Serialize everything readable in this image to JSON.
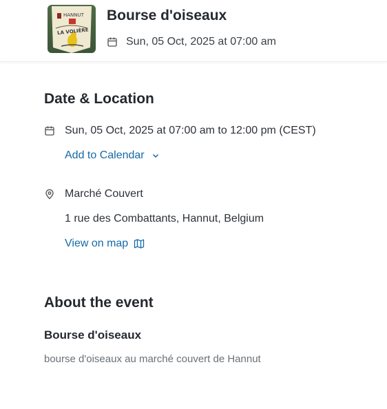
{
  "header": {
    "title": "Bourse d'oiseaux",
    "date": "Sun, 05 Oct, 2025 at 07:00 am",
    "thumbnail_icon": "event-poster-icon",
    "thumbnail_text_top": "HANNUT",
    "thumbnail_text_middle": "LA VOLIÈRE"
  },
  "date_location": {
    "heading": "Date & Location",
    "datetime": "Sun, 05 Oct, 2025 at 07:00 am to 12:00 pm (CEST)",
    "add_to_calendar": "Add to Calendar",
    "venue": "Marché Couvert",
    "address": "1 rue des Combattants, Hannut, Belgium",
    "view_on_map": "View on map"
  },
  "about": {
    "heading": "About the event",
    "subtitle": "Bourse d'oiseaux",
    "description": "bourse d'oiseaux au marché couvert de Hannut"
  },
  "colors": {
    "link": "#1569a8",
    "text": "#24292f",
    "muted": "#6b7075"
  }
}
